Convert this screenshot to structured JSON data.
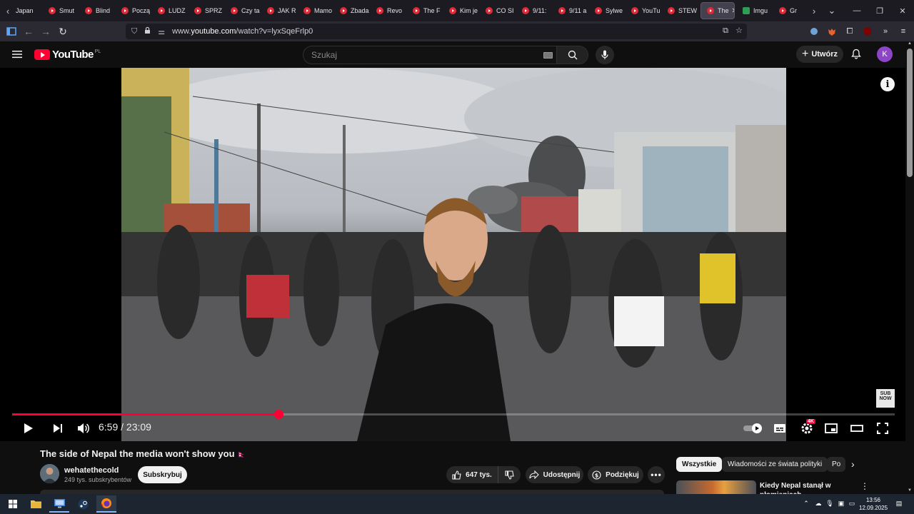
{
  "browser": {
    "tabs": [
      {
        "label": "Japan"
      },
      {
        "label": "Smut"
      },
      {
        "label": "Blind"
      },
      {
        "label": "Począ"
      },
      {
        "label": "LUDZ"
      },
      {
        "label": "SPRZ"
      },
      {
        "label": "Czy ta"
      },
      {
        "label": "JAK R"
      },
      {
        "label": "Mamo"
      },
      {
        "label": "Zbada"
      },
      {
        "label": "Revo"
      },
      {
        "label": "The F"
      },
      {
        "label": "Kim je"
      },
      {
        "label": "CO SI"
      },
      {
        "label": "9/11:"
      },
      {
        "label": "9/11 a"
      },
      {
        "label": "Sylwe"
      },
      {
        "label": "YouTu"
      },
      {
        "label": "STEW"
      },
      {
        "label": "The"
      },
      {
        "label": "Imgu"
      },
      {
        "label": "Gr"
      }
    ],
    "url": {
      "prefix": "www.",
      "domain": "youtube.com",
      "path": "/watch?v=lyxSqeFrlp0"
    },
    "extension_badge": "126"
  },
  "youtube": {
    "logo_text": "YouTube",
    "country_code": "PL",
    "search_placeholder": "Szukaj",
    "create_label": "Utwórz",
    "avatar_letter": "K"
  },
  "player": {
    "current_time": "6:59",
    "separator": "/",
    "duration": "23:09",
    "progress": 0.3018,
    "quality_badge": "4K",
    "sub_now_text": "SUB NOW"
  },
  "video": {
    "title": "The side of Nepal the media won't show you",
    "title_flag": "🇳🇵",
    "channel_name": "wehatethecold",
    "subscribers": "249 tys. subskrybentów",
    "subscribe_label": "Subskrybuj",
    "likes": "647 tys.",
    "share_label": "Udostępnij",
    "thanks_label": "Podziękuj"
  },
  "sidebar": {
    "chips": [
      {
        "label": "Wszystkie"
      },
      {
        "label": "Wiadomości ze świata polityki"
      },
      {
        "label": "Po"
      }
    ],
    "recommended": [
      {
        "title": "Kiedy Nepal stanął w płomieniach"
      }
    ]
  },
  "taskbar": {
    "time": "13:56",
    "date": "12.09.2025"
  }
}
